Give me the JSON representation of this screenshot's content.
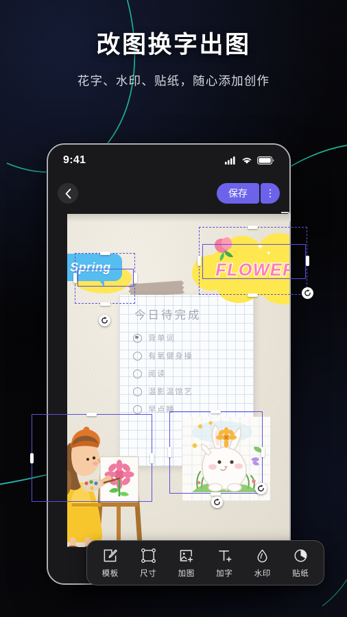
{
  "promo": {
    "headline": "改图换字出图",
    "subheadline": "花字、水印、贴纸，随心添加创作"
  },
  "phone": {
    "status_bar": {
      "time": "9:41",
      "icons": [
        "signal-icon",
        "wifi-icon",
        "battery-icon"
      ]
    },
    "nav_bar": {
      "back_icon": "chevron-left-icon",
      "save_label": "保存",
      "more_icon": "more-vertical-icon",
      "accent_color": "#6c63ea"
    },
    "canvas": {
      "background_color": "#ece7dd",
      "note": {
        "title": "今日待完成",
        "todo_items": [
          {
            "text": "背单词",
            "checked": true
          },
          {
            "text": "有氧健身操",
            "checked": false
          },
          {
            "text": "阅读",
            "checked": false
          },
          {
            "text": "温影温馆艺",
            "checked": false
          },
          {
            "text": "早点睡",
            "checked": false
          }
        ]
      },
      "stickers": [
        {
          "name": "spring-text-sticker",
          "label": "Spring",
          "bubble_color": "#55bdf0",
          "blob_color": "#ffe657",
          "selected": true
        },
        {
          "name": "flower-text-sticker",
          "label": "FLOWER",
          "text_color": "#ff7fb0",
          "cloud_color": "#ffe84f",
          "selected": true
        },
        {
          "name": "girl-painting-sticker",
          "label": "",
          "selected": true
        },
        {
          "name": "rabbit-sticker",
          "label": "",
          "selected": true
        }
      ]
    },
    "toolbar": {
      "items": [
        {
          "label": "模板",
          "icon": "template-edit-icon"
        },
        {
          "label": "尺寸",
          "icon": "crop-size-icon"
        },
        {
          "label": "加图",
          "icon": "add-image-icon"
        },
        {
          "label": "加字",
          "icon": "add-text-icon"
        },
        {
          "label": "水印",
          "icon": "watermark-icon"
        },
        {
          "label": "贴纸",
          "icon": "sticker-icon"
        }
      ]
    }
  },
  "decor": {
    "curve_color": "#1fb89a",
    "background_color": "#050507"
  }
}
